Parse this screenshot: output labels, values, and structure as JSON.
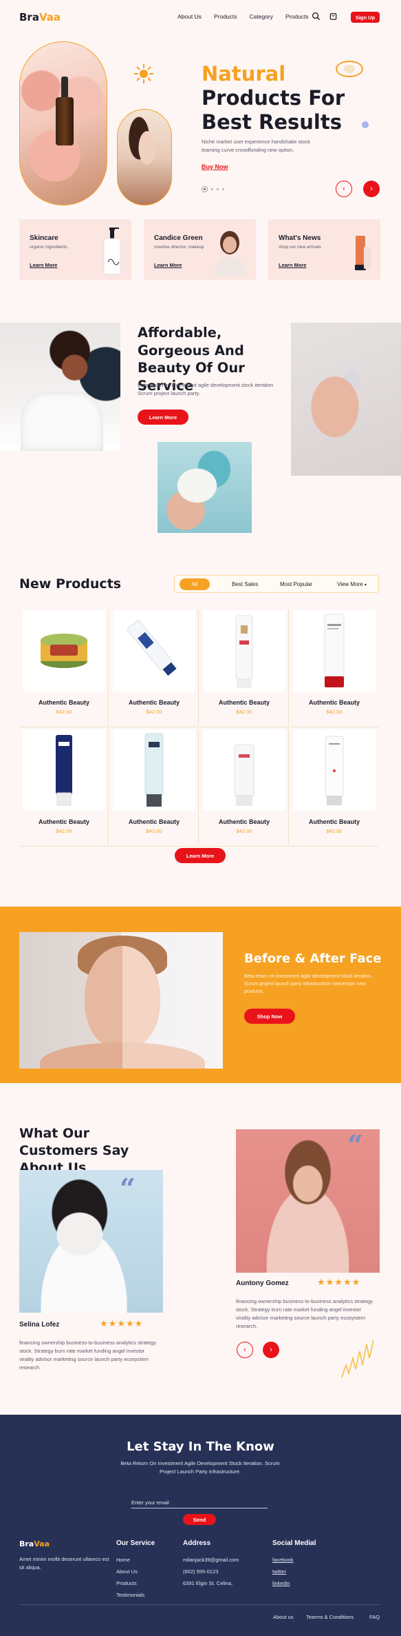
{
  "brand": {
    "name_part1": "Bra",
    "name_part2": "Vaa",
    "accent_color": "#f6a122",
    "cta_color": "#e8141a",
    "footer_bg": "#273156"
  },
  "header": {
    "nav": [
      "About Us",
      "Products",
      "Category",
      "Products"
    ],
    "search_icon": "search-icon",
    "cart_icon": "cart-icon",
    "signup_label": "Sign Up"
  },
  "hero": {
    "title_line1": "Natural",
    "title_line2": "Products For",
    "title_line3": "Best Results",
    "description": "Niche market user experience handshake stock learning curve crowdfunding new option.",
    "cta": "Buy Now",
    "prev_icon": "‹",
    "next_icon": "›"
  },
  "categories": [
    {
      "title": "Skincare",
      "subtitle": "organic ingredients",
      "link": "Learn More"
    },
    {
      "title": "Candice Green",
      "subtitle": "creative director, makeup",
      "link": "Learn More"
    },
    {
      "title": "What's News",
      "subtitle": "shop our new arrivals",
      "link": "Learn More"
    }
  ],
  "about": {
    "title": "Affordable, Gorgeous And Beauty Of Our Service",
    "description": "Beta return on investment agile development stock iteration Scrum project launch party.",
    "cta": "Learn More"
  },
  "new_products": {
    "title": "New Products",
    "filters": [
      "All",
      "Best Sales",
      "Most Popular"
    ],
    "view_more": "View More",
    "items": [
      {
        "name": "Authentic Beauty",
        "price": "$42.00"
      },
      {
        "name": "Authentic Beauty",
        "price": "$42.00"
      },
      {
        "name": "Authentic Beauty",
        "price": "$42.00"
      },
      {
        "name": "Authentic Beauty",
        "price": "$42.00"
      },
      {
        "name": "Authentic Beauty",
        "price": "$42.00"
      },
      {
        "name": "Authentic Beauty",
        "price": "$42.00"
      },
      {
        "name": "Authentic Beauty",
        "price": "$42.00"
      },
      {
        "name": "Authentic Beauty",
        "price": "$42.00"
      }
    ],
    "cta": "Learn More"
  },
  "before_after": {
    "title": "Before & After Face",
    "description": "Beta return on investment agile development stock iteration. Scrum project launch party infrastructure conversion new products.",
    "cta": "Shop Now"
  },
  "testimonials": {
    "title": "What Our Customers Say About Us",
    "stars": "★★★★★",
    "items": [
      {
        "name": "Selina Lofez",
        "text": "financing ownership business-to-business analytics strategy stock. Strategy burn rate market funding angel investor virality advisor marketing source launch party ecosystem research."
      },
      {
        "name": "Auntony Gomez",
        "text": "financing ownership business-to-business analytics strategy stock. Strategy burn rate market funding angel investor virality advisor marketing source launch party ecosystem research."
      }
    ]
  },
  "newsletter": {
    "title": "Let Stay In The Know",
    "description": "Beta Return On Investment Agile Development Stock Iteration. Scrum Project Launch Party Infrastructure.",
    "placeholder": "Enter your email",
    "send": "Send"
  },
  "footer": {
    "tagline": "Amet minim mollit deserunt ullamco est sit aliqua.",
    "service_title": "Our Service",
    "service_links": [
      "Home",
      "About Us",
      "Products",
      "Testimonials"
    ],
    "address_title": "Address",
    "address_lines": [
      "milanjack39@gmail.com",
      "(602) 555-0123",
      "6391 Elgin St. Celina,"
    ],
    "social_title": "Social Medial",
    "social_links": [
      "facebook",
      "twitter",
      "linkedin"
    ],
    "bottom_links": [
      "About us",
      "Tearms & Conditions",
      "FAQ"
    ]
  }
}
